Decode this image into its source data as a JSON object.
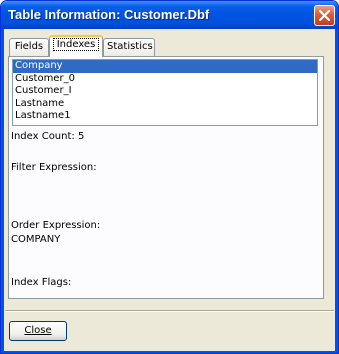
{
  "window": {
    "title": "Table Information: Customer.Dbf"
  },
  "tabs": [
    {
      "label": "Fields",
      "active": false
    },
    {
      "label": "Indexes",
      "active": true
    },
    {
      "label": "Statistics",
      "active": false
    }
  ],
  "indexes": {
    "items": [
      "Company",
      "Customer_0",
      "Customer_I",
      "Lastname",
      "Lastname1"
    ],
    "selected": "Company",
    "count_label": "Index Count:",
    "count_value": "5",
    "filter_label": "Filter Expression:",
    "filter_value": "",
    "order_label": "Order Expression:",
    "order_value": "COMPANY",
    "flags_label": "Index Flags:",
    "flags_value": ""
  },
  "footer": {
    "close_label": "Close"
  },
  "colors": {
    "titlebar": "#0054e3",
    "selection": "#316ac5",
    "close_button": "#e05a3a",
    "active_tab_accent": "#ffc83c"
  }
}
